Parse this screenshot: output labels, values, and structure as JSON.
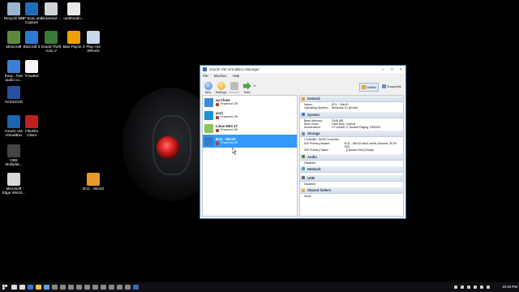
{
  "desktop_icons": [
    {
      "label": "Recycle Bin",
      "name": "recycle-bin-icon",
      "color": "#9ab6cf"
    },
    {
      "label": "HP Scan and\nCapture",
      "name": "hp-scan-icon",
      "color": "#1f6fb8"
    },
    {
      "label": "Universal-...",
      "name": "universal-app-icon",
      "color": "#d0d4d8"
    },
    {
      "label": "unetbootin...",
      "name": "unetbootin-icon",
      "color": "#e8e8e8"
    },
    {
      "label": "Minecraft",
      "name": "minecraft-icon",
      "color": "#5c8a3a"
    },
    {
      "label": "BioCraft II",
      "name": "biocraft-icon",
      "color": "#2d7bd1"
    },
    {
      "label": "Grand Theft\nAuto V",
      "name": "gta-icon",
      "color": "#3a7a3a"
    },
    {
      "label": "Max Payne 3",
      "name": "max-payne-icon",
      "color": "#f0a000"
    },
    {
      "label": "Play Hot\nWheels",
      "name": "hot-wheels-icon",
      "color": "#c9d8ea"
    },
    {
      "label": "freac - free\naudio co...",
      "name": "freac-icon",
      "color": "#3c7fd6"
    },
    {
      "label": "TrivaBot",
      "name": "trivabot-file-icon",
      "color": "#f5f5f5"
    },
    {
      "label": "AVSmDVD",
      "name": "avsmdvd-icon",
      "color": "#2a4fa0"
    },
    {
      "label": "Oracle VM\nVirtualBox",
      "name": "virtualbox-desktop-icon",
      "color": "#1e63b0"
    },
    {
      "label": "FileZilla\nClient",
      "name": "filezilla-icon",
      "color": "#bf1f1f"
    },
    {
      "label": "OBS\nMultiplat...",
      "name": "obs-icon",
      "color": "#444"
    },
    {
      "label": "Microsoft\nEdge Win10...",
      "name": "edge-vm-icon",
      "color": "#d8d8d8"
    },
    {
      "label": "IE11 - Win10",
      "name": "ie11-vm-desktop-icon",
      "color": "#e89a2a"
    }
  ],
  "window": {
    "title": "Oracle VM VirtualBox Manager",
    "menu": [
      "File",
      "Machine",
      "Help"
    ],
    "toolbar": [
      "New",
      "Settings",
      "Discard",
      "Start"
    ],
    "details_button": "Details",
    "snapshots_button": "Snapshots",
    "vms": [
      {
        "name": "xp Clone",
        "state": "Powered Off",
        "os_color": "#3a8ad8",
        "selected": false
      },
      {
        "name": "arch",
        "state": "Powered Off",
        "os_color": "#1793d1",
        "selected": false
      },
      {
        "name": "Linux Mint 17",
        "state": "Powered Off",
        "os_color": "#8fc35a",
        "selected": false
      },
      {
        "name": "IE11 - Win10",
        "state": "Powered Off",
        "os_color": "#2f7fd3",
        "selected": true
      }
    ],
    "sections": {
      "general": {
        "title": "General",
        "rows": [
          {
            "k": "Name:",
            "v": "IE11 - Win10"
          },
          {
            "k": "Operating System:",
            "v": "Windows 10 (64-bit)"
          }
        ]
      },
      "system": {
        "title": "System",
        "rows": [
          {
            "k": "Base Memory:",
            "v": "2048 MB"
          },
          {
            "k": "Boot Order:",
            "v": "Hard Disk, Optical"
          },
          {
            "k": "Acceleration:",
            "v": "VT-x/AMD-V, Nested Paging, PAE/NX"
          }
        ]
      },
      "storage": {
        "title": "Storage",
        "rows": [
          {
            "k": "Controller: SATA Controller",
            "v": ""
          },
          {
            "k": "  IDE Primary Master:",
            "v": "IE11 - Win10-disk1.vmdk (Normal, 40.00 GB)"
          },
          {
            "k": "  IDE Primary Slave:",
            "v": "[Optical Drive] Empty"
          }
        ]
      },
      "audio": {
        "title": "Audio",
        "value": "Disabled"
      },
      "network": {
        "title": "Network"
      },
      "usb": {
        "title": "USB",
        "value": "Disabled"
      },
      "shared": {
        "title": "Shared folders",
        "value": "None"
      }
    }
  },
  "taskbar": {
    "clock": "10:46 PM",
    "apps": [
      {
        "name": "taskbar-search-icon",
        "color": "#ddd"
      },
      {
        "name": "taskbar-taskview-icon",
        "color": "#ddd"
      },
      {
        "name": "taskbar-edge-icon",
        "color": "#2b7bd6"
      },
      {
        "name": "taskbar-explorer-icon",
        "color": "#f2c14e"
      },
      {
        "name": "taskbar-store-icon",
        "color": "#5aa0e6"
      },
      {
        "name": "taskbar-app-icon-1",
        "color": "#888"
      },
      {
        "name": "taskbar-app-icon-2",
        "color": "#888"
      },
      {
        "name": "taskbar-app-icon-3",
        "color": "#888"
      },
      {
        "name": "taskbar-app-icon-4",
        "color": "#888"
      },
      {
        "name": "taskbar-app-icon-5",
        "color": "#888"
      },
      {
        "name": "taskbar-app-icon-6",
        "color": "#888"
      },
      {
        "name": "taskbar-app-icon-7",
        "color": "#888"
      },
      {
        "name": "taskbar-app-icon-8",
        "color": "#888"
      },
      {
        "name": "taskbar-app-icon-9",
        "color": "#888"
      },
      {
        "name": "taskbar-app-icon-10",
        "color": "#888"
      },
      {
        "name": "taskbar-virtualbox-icon",
        "color": "#2f6db5"
      }
    ]
  }
}
